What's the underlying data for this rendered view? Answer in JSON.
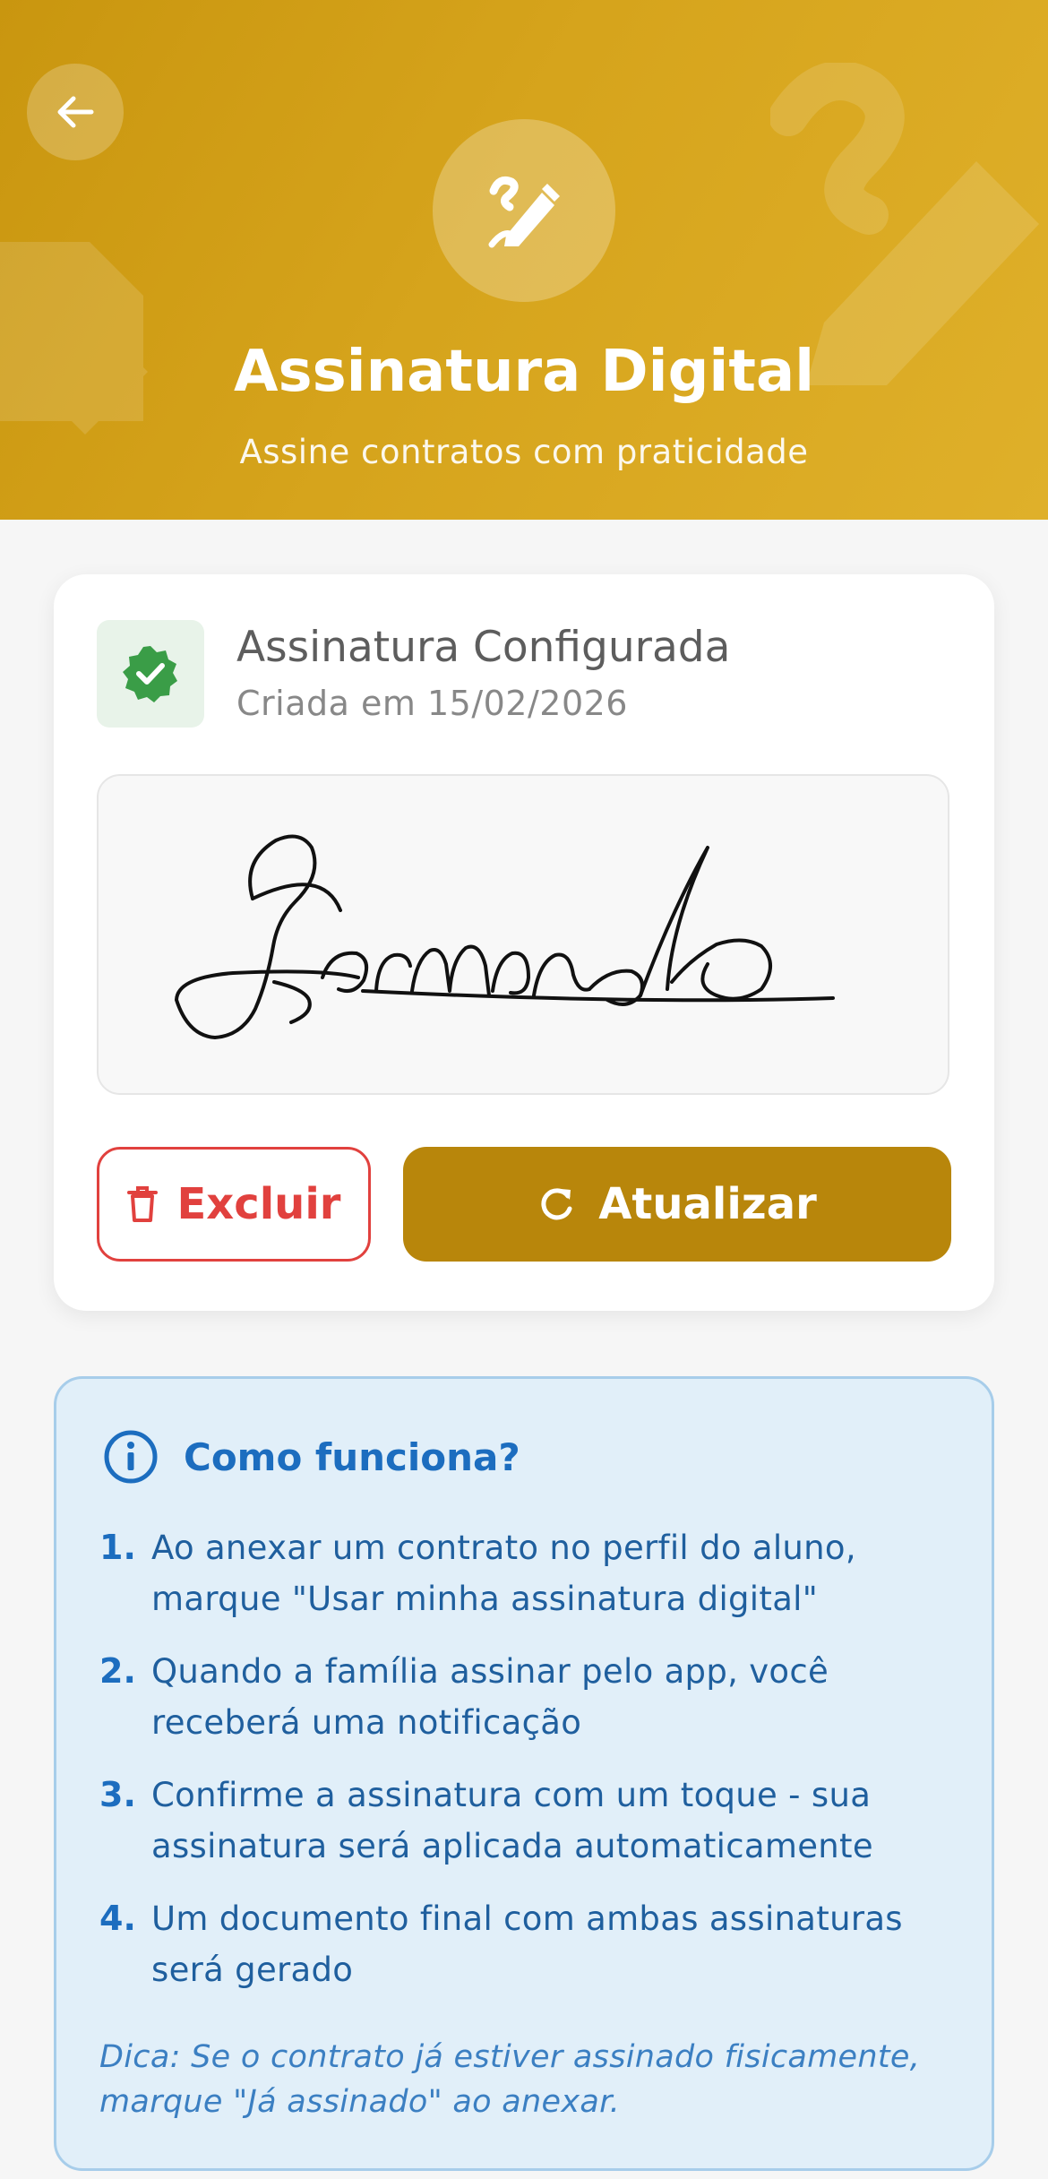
{
  "header": {
    "title": "Assinatura Digital",
    "subtitle": "Assine contratos com praticidade",
    "back_icon": "arrow-left-icon",
    "hero_icon": "signature-icon",
    "color": "#d1a018"
  },
  "signature_card": {
    "status_title": "Assinatura Configurada",
    "created_text": "Criada em 15/02/2026",
    "status_icon": "verified-badge-icon",
    "status_color": "#3a9d47",
    "delete_label": "Excluir",
    "update_label": "Atualizar",
    "delete_color": "#e1413e",
    "update_color": "#b8860b"
  },
  "info": {
    "title": "Como funciona?",
    "steps": [
      {
        "num": "1.",
        "text": "Ao anexar um contrato no perfil do aluno, marque \"Usar minha assinatura digital\""
      },
      {
        "num": "2.",
        "text": "Quando a família assinar pelo app, você receberá uma notificação"
      },
      {
        "num": "3.",
        "text": "Confirme a assinatura com um toque - sua assinatura será aplicada automaticamente"
      },
      {
        "num": "4.",
        "text": "Um documento final com ambas assinaturas será gerado"
      }
    ],
    "tip": "Dica: Se o contrato já estiver assinado fisicamente, marque \"Já assinado\" ao anexar."
  }
}
